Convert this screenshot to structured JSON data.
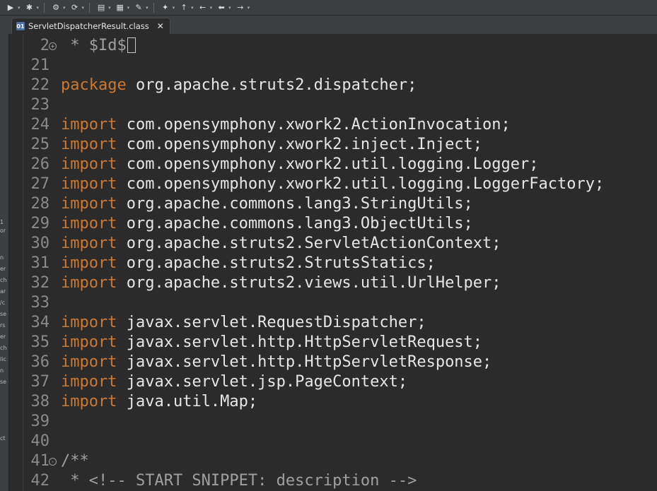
{
  "toolbar": {
    "buttons": [
      {
        "icon": "run-icon",
        "glyph": "▶"
      },
      {
        "icon": "debug-icon",
        "glyph": "✱"
      },
      {
        "icon": "build-icon",
        "glyph": "⚙"
      },
      {
        "icon": "refresh-icon",
        "glyph": "⟳"
      },
      {
        "icon": "open-folder-icon",
        "glyph": "▤"
      },
      {
        "icon": "new-folder-icon",
        "glyph": "▦"
      },
      {
        "icon": "pencil-icon",
        "glyph": "✎"
      },
      {
        "icon": "annotation-icon",
        "glyph": "✦"
      },
      {
        "icon": "up-arrow-icon",
        "glyph": "↑"
      },
      {
        "icon": "back-arrow-icon",
        "glyph": "←"
      },
      {
        "icon": "back-dropdown-icon",
        "glyph": "⬅"
      },
      {
        "icon": "forward-arrow-icon",
        "glyph": "→"
      }
    ]
  },
  "tab": {
    "title": "ServletDispatcherResult.class",
    "close_glyph": "✕",
    "icon": "class-file-icon",
    "icon_glyph": "01"
  },
  "left_panel": {
    "fragments": [
      "1",
      "or",
      "n",
      "er",
      "ch",
      "ar",
      "/c",
      "se",
      "rs",
      "er",
      "ch",
      "lic",
      "n",
      "se",
      "ct"
    ]
  },
  "editor": {
    "lines": [
      {
        "num": "2",
        "fold": "+",
        "tokens": [
          {
            "t": " * $Id$",
            "c": "cm"
          }
        ],
        "cursor": true
      },
      {
        "num": "21",
        "tokens": []
      },
      {
        "num": "22",
        "tokens": [
          {
            "t": "package",
            "c": "kw"
          },
          {
            "t": " org.apache.struts2.dispatcher;",
            "c": ""
          }
        ]
      },
      {
        "num": "23",
        "tokens": []
      },
      {
        "num": "24",
        "tokens": [
          {
            "t": "import",
            "c": "kw"
          },
          {
            "t": " com.opensymphony.xwork2.ActionInvocation;",
            "c": ""
          }
        ]
      },
      {
        "num": "25",
        "tokens": [
          {
            "t": "import",
            "c": "kw"
          },
          {
            "t": " com.opensymphony.xwork2.inject.Inject;",
            "c": ""
          }
        ]
      },
      {
        "num": "26",
        "tokens": [
          {
            "t": "import",
            "c": "kw"
          },
          {
            "t": " com.opensymphony.xwork2.util.logging.Logger;",
            "c": ""
          }
        ]
      },
      {
        "num": "27",
        "tokens": [
          {
            "t": "import",
            "c": "kw"
          },
          {
            "t": " com.opensymphony.xwork2.util.logging.LoggerFactory;",
            "c": ""
          }
        ]
      },
      {
        "num": "28",
        "tokens": [
          {
            "t": "import",
            "c": "kw"
          },
          {
            "t": " org.apache.commons.lang3.StringUtils;",
            "c": ""
          }
        ]
      },
      {
        "num": "29",
        "tokens": [
          {
            "t": "import",
            "c": "kw"
          },
          {
            "t": " org.apache.commons.lang3.ObjectUtils;",
            "c": ""
          }
        ]
      },
      {
        "num": "30",
        "tokens": [
          {
            "t": "import",
            "c": "kw"
          },
          {
            "t": " org.apache.struts2.ServletActionContext;",
            "c": ""
          }
        ]
      },
      {
        "num": "31",
        "tokens": [
          {
            "t": "import",
            "c": "kw"
          },
          {
            "t": " org.apache.struts2.StrutsStatics;",
            "c": ""
          }
        ]
      },
      {
        "num": "32",
        "tokens": [
          {
            "t": "import",
            "c": "kw"
          },
          {
            "t": " org.apache.struts2.views.util.UrlHelper;",
            "c": ""
          }
        ]
      },
      {
        "num": "33",
        "tokens": []
      },
      {
        "num": "34",
        "tokens": [
          {
            "t": "import",
            "c": "kw"
          },
          {
            "t": " javax.servlet.RequestDispatcher;",
            "c": ""
          }
        ]
      },
      {
        "num": "35",
        "tokens": [
          {
            "t": "import",
            "c": "kw"
          },
          {
            "t": " javax.servlet.http.HttpServletRequest;",
            "c": ""
          }
        ]
      },
      {
        "num": "36",
        "tokens": [
          {
            "t": "import",
            "c": "kw"
          },
          {
            "t": " javax.servlet.http.HttpServletResponse;",
            "c": ""
          }
        ]
      },
      {
        "num": "37",
        "tokens": [
          {
            "t": "import",
            "c": "kw"
          },
          {
            "t": " javax.servlet.jsp.PageContext;",
            "c": ""
          }
        ]
      },
      {
        "num": "38",
        "tokens": [
          {
            "t": "import",
            "c": "kw"
          },
          {
            "t": " java.util.Map;",
            "c": ""
          }
        ]
      },
      {
        "num": "39",
        "tokens": []
      },
      {
        "num": "40",
        "tokens": []
      },
      {
        "num": "41",
        "fold": "-",
        "tokens": [
          {
            "t": "/**",
            "c": "cm"
          }
        ]
      },
      {
        "num": "42",
        "tokens": [
          {
            "t": " * <!-- START SNIPPET: description -->",
            "c": "cm"
          }
        ]
      }
    ]
  },
  "colors": {
    "background": "#2b2b2b",
    "keyword": "#cc7832",
    "text": "#e6e6e6",
    "comment": "#a0a0a0",
    "line_number": "#8a8a8a"
  }
}
